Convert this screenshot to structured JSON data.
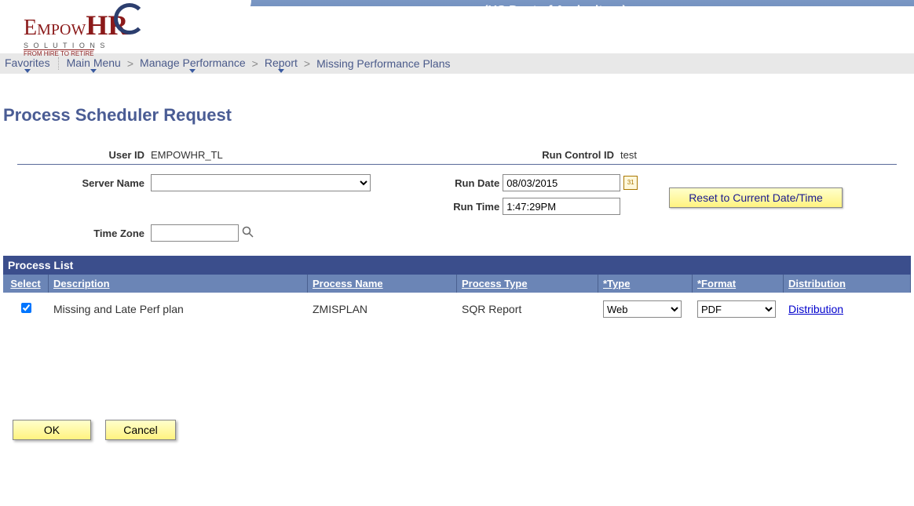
{
  "header": {
    "title": "(US Dept of Agriculture)"
  },
  "logo": {
    "empow": "Empow",
    "hr": "HR",
    "solutions": "S O L U T I O N S",
    "tagline": "FROM HIRE TO RETIRE"
  },
  "breadcrumb": {
    "items": [
      "Favorites",
      "Main Menu",
      "Manage Performance",
      "Report",
      "Missing Performance Plans"
    ],
    "sep": ">"
  },
  "page": {
    "title": "Process Scheduler Request"
  },
  "form": {
    "user_id_label": "User ID",
    "user_id_value": "EMPOWHR_TL",
    "run_control_label": "Run Control ID",
    "run_control_value": "test",
    "server_label": "Server Name",
    "server_value": "",
    "run_date_label": "Run Date",
    "run_date_value": "08/03/2015",
    "run_time_label": "Run Time",
    "run_time_value": "1:47:29PM",
    "timezone_label": "Time Zone",
    "timezone_value": "",
    "reset_label": "Reset to Current Date/Time",
    "cal_day": "31"
  },
  "process_list": {
    "caption": "Process List",
    "headers": {
      "select": "Select",
      "description": "Description",
      "process_name": "Process Name",
      "process_type": "Process Type",
      "type": "*Type",
      "format": "*Format",
      "distribution": "Distribution"
    },
    "rows": [
      {
        "checked": true,
        "description": "Missing and Late Perf plan",
        "process_name": "ZMISPLAN",
        "process_type": "SQR Report",
        "type": "Web",
        "format": "PDF",
        "distribution": "Distribution"
      }
    ]
  },
  "buttons": {
    "ok": "OK",
    "cancel": "Cancel"
  }
}
